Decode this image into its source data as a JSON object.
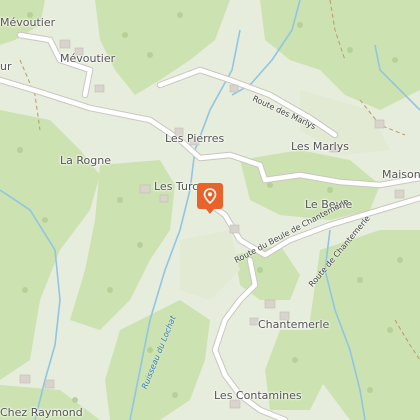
{
  "map": {
    "places": [
      {
        "name": "Mévoutier"
      },
      {
        "name": "Mévoutier"
      },
      {
        "name": "ur"
      },
      {
        "name": "Les Pierres"
      },
      {
        "name": "La Rogne"
      },
      {
        "name": "Les Turc"
      },
      {
        "name": "Les Marlys"
      },
      {
        "name": "Maison"
      },
      {
        "name": "Le Beule"
      },
      {
        "name": "Chantemerle"
      },
      {
        "name": "Les Contamines"
      },
      {
        "name": "Chez Raymond"
      }
    ],
    "roads": [
      {
        "name": "Route des Marlys"
      },
      {
        "name": "Route du Beule de Chantemerle"
      },
      {
        "name": "Route de Chantemerle"
      }
    ],
    "waterways": [
      {
        "name": "Ruisseau du Lochat"
      }
    ]
  },
  "colors": {
    "forest": "#cfe3b4",
    "meadow": "#e7eddc",
    "water": "#8fc6e3",
    "road": "#ffffff",
    "marker": "#e8632b",
    "building": "#d8d3cc"
  },
  "marker": {
    "icon": "location-pin-icon"
  }
}
